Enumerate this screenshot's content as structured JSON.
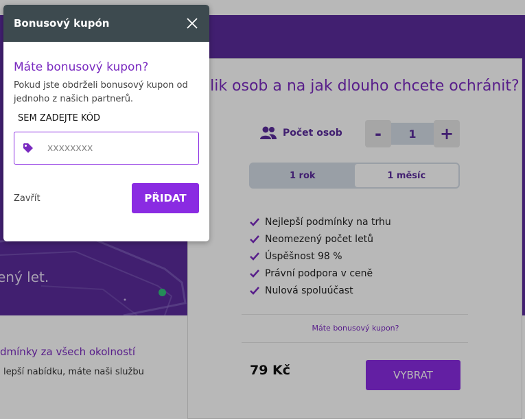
{
  "background": {
    "hero_text": "ený let.",
    "bottom_title": "dmínky za všech okolností",
    "bottom_sub": "lepší nabídku, máte naši službu",
    "card": {
      "question": "Kolik osob a na jak dlouho chcete ochránit?",
      "persons_label": "Počet osob",
      "persons_icon": "people-icon",
      "minus_label": "-",
      "plus_label": "+",
      "quantity": "1",
      "period_options": [
        "1 rok",
        "1 měsíc"
      ],
      "period_selected": "1 měsíc",
      "features": [
        "Nejlepší podmínky na trhu",
        "Neomezený počet letů",
        "Úspěšnost 98 %",
        "Právní podpora v ceně",
        "Nulová spoluúčast"
      ],
      "coupon_link": "Máte bonusový kupon?",
      "price": "79 Kč",
      "select_button": "VYBRAT"
    }
  },
  "modal": {
    "title": "Bonusový kupón",
    "close_icon": "close-icon",
    "heading": "Máte bonusový kupon?",
    "description": "Pokud jste obdrželi bonusový kupon od jednoho z našich partnerů.",
    "code_label": "SEM ZADEJTE KÓD",
    "code_field": {
      "value": "",
      "placeholder": "xxxxxxxx",
      "icon": "tag-icon"
    },
    "close_link": "Zavřít",
    "add_button": "PŘIDAT"
  },
  "colors": {
    "accent": "#8a2be2",
    "heading_purple": "#7a2ac0",
    "hero_purple": "#5b2c9c",
    "modal_header": "#3d4a4f",
    "success_dot": "#33c37a"
  }
}
